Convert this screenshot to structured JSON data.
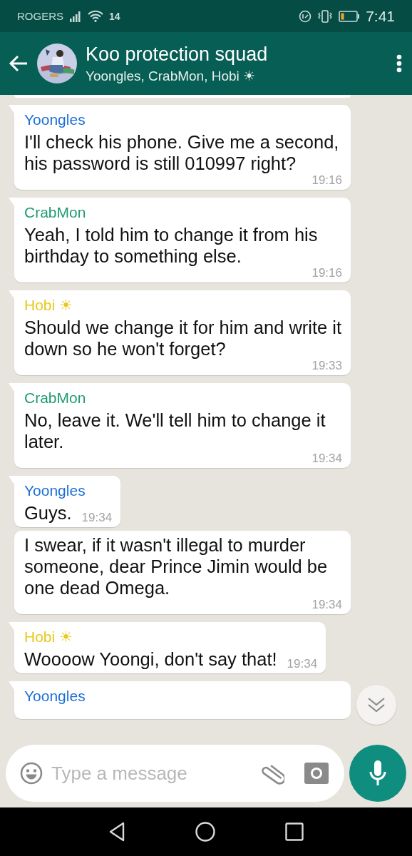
{
  "status_bar": {
    "carrier": "ROGERS",
    "network_badge": "14",
    "time": "7:41"
  },
  "header": {
    "title": "Koo protection squad",
    "subtitle": "Yoongles, CrabMon, Hobi ☀"
  },
  "messages": [
    {
      "sender": "Yoongles",
      "color": "#1b6fd5",
      "text": "I'll check his phone. Give me a second, his password is still 010997 right?",
      "time": "19:16",
      "tail": true
    },
    {
      "sender": "CrabMon",
      "color": "#1f9b74",
      "text": "Yeah, I told him to change it from his birthday to something else.",
      "time": "19:16",
      "tail": true
    },
    {
      "sender": "Hobi ☀",
      "color": "#e9c81c",
      "text": "Should we change it for him and write it down so he won't forget?",
      "time": "19:33",
      "tail": true
    },
    {
      "sender": "CrabMon",
      "color": "#1f9b74",
      "text": "No, leave it. We'll tell him to change it later.",
      "time": "19:34",
      "tail": true
    },
    {
      "sender": "Yoongles",
      "color": "#1b6fd5",
      "text": "Guys.",
      "time": "19:34",
      "tail": true
    },
    {
      "text": "I swear, if it wasn't illegal to murder someone, dear Prince Jimin would be one dead Omega.",
      "time": "19:34",
      "tail": false
    },
    {
      "sender": "Hobi ☀",
      "color": "#e9c81c",
      "text": "Woooow Yoongi, don't say that!",
      "time": "19:34",
      "tail": true
    },
    {
      "sender": "Yoongles",
      "color": "#1b6fd5",
      "tail": true
    }
  ],
  "composer": {
    "placeholder": "Type a message"
  }
}
